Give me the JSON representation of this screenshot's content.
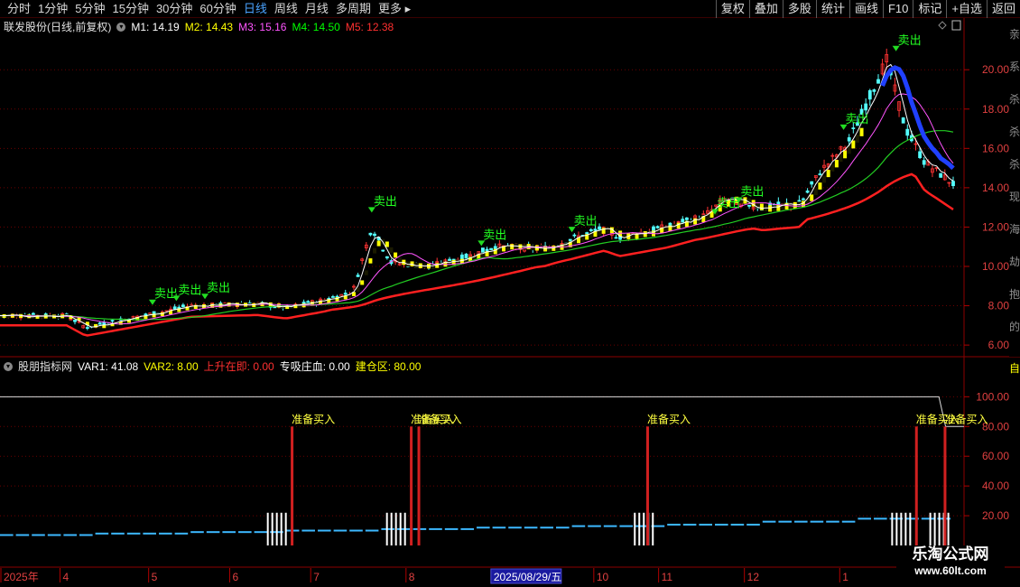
{
  "toolbar": {
    "tabs": [
      "分时",
      "1分钟",
      "5分钟",
      "15分钟",
      "30分钟",
      "60分钟",
      "日线",
      "周线",
      "月线",
      "多周期",
      "更多"
    ],
    "active_tab": "日线",
    "right_buttons": [
      "复权",
      "叠加",
      "多股",
      "统计",
      "画线",
      "F10",
      "标记",
      "+自选",
      "返回"
    ]
  },
  "main_legend": {
    "stock": "联发股份(日线,前复权)",
    "items": [
      {
        "label": "M1: 14.19",
        "color": "#ffffff"
      },
      {
        "label": "M2: 14.43",
        "color": "#ffff00"
      },
      {
        "label": "M3: 15.16",
        "color": "#ff55ff"
      },
      {
        "label": "M4: 14.50",
        "color": "#00ff00"
      },
      {
        "label": "M5: 12.38",
        "color": "#ff3030"
      }
    ]
  },
  "indicator_legend": {
    "name": "股朋指标网",
    "items": [
      {
        "label": "VAR1: 41.08",
        "color": "#ffffff"
      },
      {
        "label": "VAR2: 8.00",
        "color": "#ffff00"
      },
      {
        "label": "上升在即: 0.00",
        "color": "#ff3030"
      },
      {
        "label": "专吸庄血: 0.00",
        "color": "#ffffff"
      },
      {
        "label": "建仓区: 80.00",
        "color": "#ffff00"
      }
    ]
  },
  "chart_data": [
    {
      "type": "candlestick",
      "title": "联发股份(日线,前复权)",
      "y_ticks": [
        "6.00",
        "8.00",
        "10.00",
        "12.00",
        "14.00",
        "16.00",
        "18.00",
        "20.00"
      ],
      "ylim": [
        5.5,
        21.8
      ],
      "series": [
        {
          "name": "M1",
          "color": "#ffffff",
          "last": 14.19
        },
        {
          "name": "M2",
          "color": "#ffff00",
          "last": 14.43
        },
        {
          "name": "M3",
          "color": "#ff55ff",
          "last": 15.16
        },
        {
          "name": "M4",
          "color": "#00ff00",
          "last": 14.5
        },
        {
          "name": "M5",
          "color": "#ff3030",
          "last": 12.38
        }
      ],
      "approx_close_path": [
        [
          0,
          7.5
        ],
        [
          0.07,
          7.5
        ],
        [
          0.09,
          6.9
        ],
        [
          0.14,
          7.4
        ],
        [
          0.2,
          8.0
        ],
        [
          0.27,
          8.1
        ],
        [
          0.3,
          7.9
        ],
        [
          0.34,
          8.3
        ],
        [
          0.37,
          8.7
        ],
        [
          0.39,
          12.0
        ],
        [
          0.41,
          10.2
        ],
        [
          0.45,
          10.0
        ],
        [
          0.49,
          10.5
        ],
        [
          0.52,
          11.0
        ],
        [
          0.57,
          10.9
        ],
        [
          0.6,
          11.4
        ],
        [
          0.63,
          11.9
        ],
        [
          0.65,
          11.5
        ],
        [
          0.7,
          12.0
        ],
        [
          0.74,
          12.6
        ],
        [
          0.76,
          13.4
        ],
        [
          0.8,
          13.0
        ],
        [
          0.84,
          13.2
        ],
        [
          0.86,
          14.8
        ],
        [
          0.89,
          16.3
        ],
        [
          0.93,
          20.5
        ],
        [
          0.95,
          17.0
        ],
        [
          0.97,
          15.3
        ],
        [
          1.0,
          14.2
        ]
      ],
      "annotations": [
        {
          "text": "卖出",
          "at": 0.16,
          "price": 7.9
        },
        {
          "text": "卖出",
          "at": 0.185,
          "price": 8.1
        },
        {
          "text": "卖出",
          "at": 0.215,
          "price": 8.2
        },
        {
          "text": "卖出",
          "at": 0.39,
          "price": 12.6
        },
        {
          "text": "卖出",
          "at": 0.505,
          "price": 10.9
        },
        {
          "text": "卖出",
          "at": 0.6,
          "price": 11.6
        },
        {
          "text": "卖出",
          "at": 0.75,
          "price": 12.5
        },
        {
          "text": "卖出",
          "at": 0.775,
          "price": 13.1
        },
        {
          "text": "卖出",
          "at": 0.885,
          "price": 16.8
        },
        {
          "text": "卖出",
          "at": 0.94,
          "price": 20.8
        }
      ]
    },
    {
      "type": "bar",
      "title": "股朋指标网",
      "y_ticks": [
        "20.00",
        "40.00",
        "60.00",
        "80.00",
        "100.00"
      ],
      "ylim": [
        0,
        116
      ],
      "var1_line": 100,
      "buy_signals": [
        {
          "text": "准备买入",
          "at": 0.305
        },
        {
          "text": "准备买入",
          "at": 0.43
        },
        {
          "text": "准备买入",
          "at": 0.438
        },
        {
          "text": "准备买入",
          "at": 0.678
        },
        {
          "text": "准备买入",
          "at": 0.96
        },
        {
          "text": "准备买入",
          "at": 0.99
        }
      ],
      "white_bar_groups": [
        0.28,
        0.405,
        0.665,
        0.935,
        0.975
      ],
      "cyan_baseline_levels": [
        7,
        8,
        9,
        10,
        11,
        12,
        13,
        14,
        16,
        18
      ]
    }
  ],
  "x_axis": {
    "labels": [
      "2025年",
      "4",
      "5",
      "6",
      "7",
      "8",
      "10",
      "11",
      "12",
      "1"
    ],
    "highlight": "2025/08/29/五"
  },
  "right_edge_text": "亲系杀杀杀现海劫抱的",
  "right_lower_tag": "自",
  "watermark": {
    "title": "乐淘公式网",
    "url": "www.60lt.com"
  }
}
